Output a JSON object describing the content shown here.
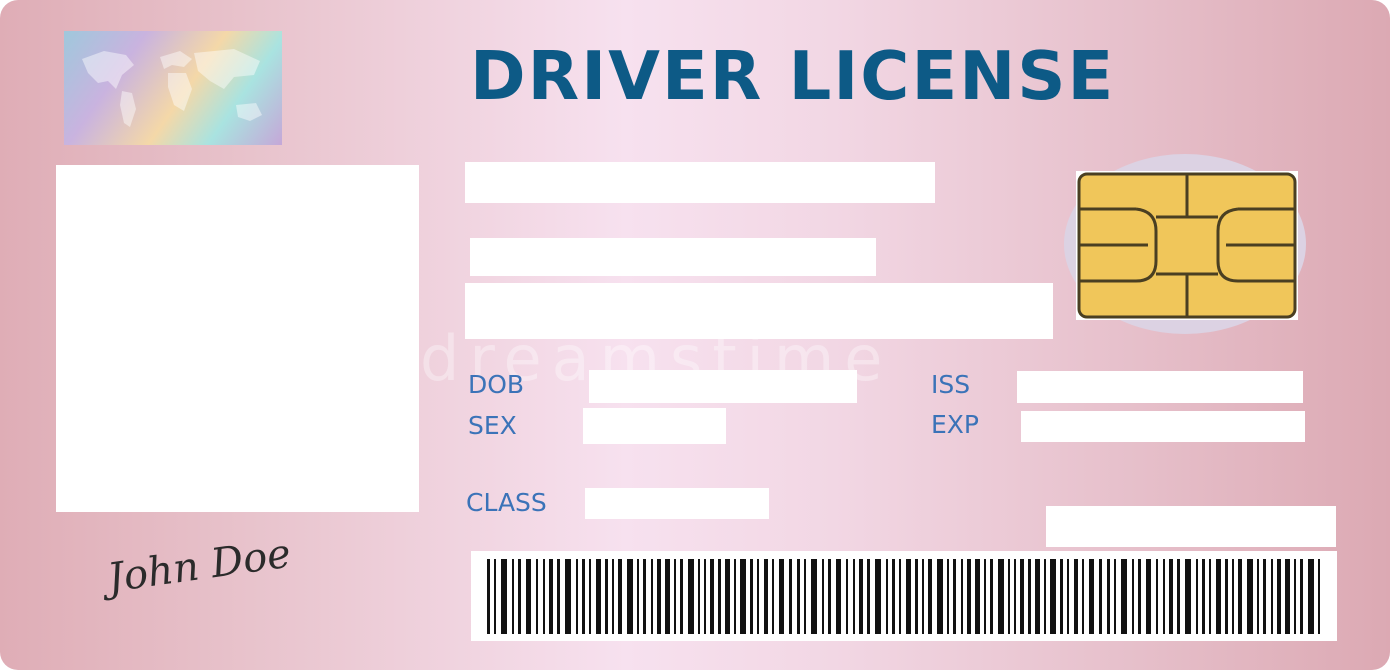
{
  "card": {
    "title": "DRIVER LICENSE",
    "labels": {
      "dob": "DOB",
      "sex": "SEX",
      "class": "CLASS",
      "iss": "ISS",
      "exp": "EXP"
    },
    "watermark": "dreamstime",
    "signature": "John Doe",
    "colors": {
      "title": "#0d5a86",
      "labels": "#3b73b8",
      "chip": "#f0c65a"
    }
  }
}
